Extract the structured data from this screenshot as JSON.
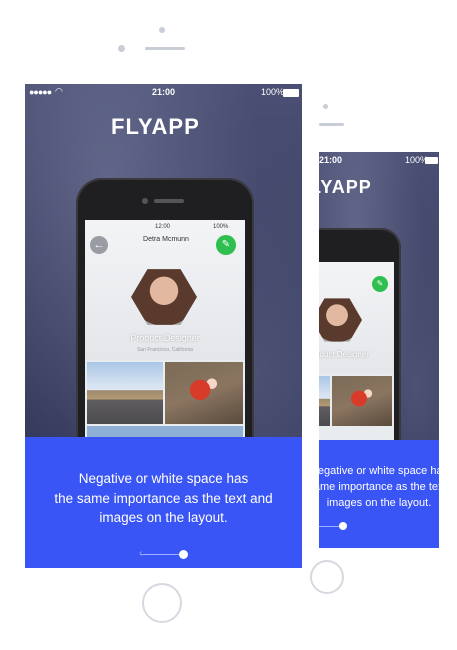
{
  "left_screen": {
    "status": {
      "time": "21:00",
      "battery": "100%"
    },
    "logo": "FLYAPP",
    "phone_ui": {
      "time": "12:00",
      "battery": "100%",
      "profile_name": "Detra Mcmunn",
      "profile_sub": "",
      "role": "Product Designer",
      "location": "San Francisco, California"
    },
    "caption": [
      "Negative or white space has",
      "the same importance as the text and",
      "images on the layout."
    ]
  },
  "right_screen": {
    "status": {
      "time": "21:00",
      "battery": "100%"
    },
    "logo": "FLYAPP",
    "role": "Product Designer",
    "caption": [
      "Negative or white space has",
      "the same importance as the text and",
      "images on the layout."
    ]
  },
  "colors": {
    "accent_blue": "#3a55f5",
    "green": "#2fbf4e"
  },
  "icons": [
    "wifi-icon",
    "battery-icon",
    "back-arrow-icon",
    "pencil-icon",
    "arrow-left-icon"
  ]
}
